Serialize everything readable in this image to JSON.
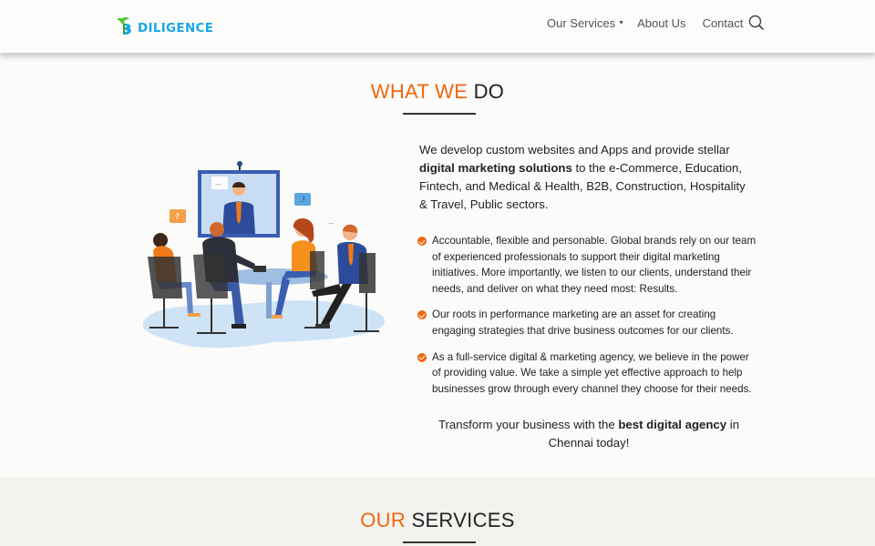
{
  "brand": {
    "name": "DILIGENCE",
    "accent": "#f0660f",
    "blue": "#1aa6e3",
    "green": "#5cc23b"
  },
  "nav": {
    "items": [
      {
        "label": "Our Services",
        "has_dropdown": true
      },
      {
        "label": "About Us"
      },
      {
        "label": "Contact"
      }
    ],
    "search_icon": "search-icon"
  },
  "what_we_do": {
    "title_accent": "WHAT WE",
    "title_rest": "DO",
    "intro": {
      "p1": "We develop custom websites and Apps and provide stellar ",
      "b1": "digital marketing solutions",
      "p2": " to the e-Commerce, Education, Fintech, and Medical & Health, B2B, Construction, Hospitality & Travel, Public sectors."
    },
    "bullets": [
      "Accountable, flexible and personable. Global brands rely on our team of experienced professionals to support their digital marketing initiatives. More importantly, we listen to our clients, understand their needs, and deliver on what they need most: Results.",
      "Our roots in performance marketing are an asset for creating engaging strategies that drive business outcomes for our clients.",
      "As a full-service digital & marketing agency, we believe in the power of providing value. We take a simple yet effective approach to help businesses grow through every channel they choose for their needs."
    ],
    "closing": {
      "p1": "Transform your business with the ",
      "b1": "best digital agency",
      "p2": " in Chennai today!"
    },
    "illustration_icon": "video-meeting-illustration"
  },
  "our_services": {
    "title_accent": "OUR",
    "title_rest": "SERVICES"
  }
}
